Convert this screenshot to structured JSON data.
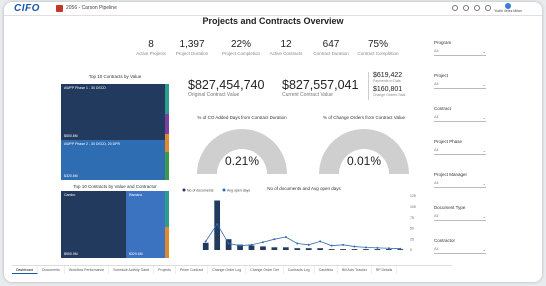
{
  "topbar": {
    "logo": "CIFO",
    "project_name": "2056 - Carson Pipeline",
    "user_name": "Yudhi Velez Milan"
  },
  "page_title": "Projects and Contracts Overview",
  "kpis": [
    {
      "value": "8",
      "label": "Active Projects"
    },
    {
      "value": "1,397",
      "label": "Project Duration"
    },
    {
      "value": "22%",
      "label": "Project Completion"
    },
    {
      "value": "12",
      "label": "Active Contracts"
    },
    {
      "value": "647",
      "label": "Contract Duration"
    },
    {
      "value": "75%",
      "label": "Contract Completion"
    }
  ],
  "money": {
    "original_value": "$827,454,740",
    "original_label": "Original Contract Value",
    "current_value": "$827,557,041",
    "current_label": "Current Contract Value",
    "side1_value": "$619,422",
    "side1_label": "Payments to Date",
    "side2_value": "$160,801",
    "side2_label": "Change Orders Total"
  },
  "treemap1": {
    "title": "Top 10 Contracts by Value",
    "a_label": "AWPP Phase 1 - 30 DSCD",
    "a_value": "$500.8M",
    "b_label": "AWPP Phase 2 - 30 DSCD, 20 DPR",
    "b_value": "$320.6M"
  },
  "treemap2": {
    "title": "Top 10 Contracts by Value and Contractor",
    "a_label": "Cambo",
    "a_value": "$500.9M",
    "b_label": "Ramano",
    "b_value": "$320.6M"
  },
  "gauge1": {
    "title": "% of CO Added Days from Contract Duration",
    "value": "0.21%",
    "fraction": 0.0021
  },
  "gauge2": {
    "title": "% of Change Orders from Contract Value",
    "value": "0.01%",
    "fraction": 0.0001
  },
  "filters": [
    {
      "label": "Program",
      "value": "All"
    },
    {
      "label": "Project",
      "value": "All"
    },
    {
      "label": "Contract",
      "value": "All"
    },
    {
      "label": "Project Phase",
      "value": "All"
    },
    {
      "label": "Project Manager",
      "value": "All"
    },
    {
      "label": "Document Type",
      "value": "All"
    },
    {
      "label": "Contractor",
      "value": "All"
    }
  ],
  "tabs": [
    {
      "label": "Dashboard",
      "active": true
    },
    {
      "label": "Documents",
      "active": false
    },
    {
      "label": "Workflow Performance",
      "active": false
    },
    {
      "label": "Schedule Activity Gantt",
      "active": false
    },
    {
      "label": "Projects",
      "active": false
    },
    {
      "label": "Prime Contract",
      "active": false
    },
    {
      "label": "Change Order Log",
      "active": false
    },
    {
      "label": "Change Order Det",
      "active": false
    },
    {
      "label": "Contracts Log",
      "active": false
    },
    {
      "label": "Cashflow",
      "active": false
    },
    {
      "label": "Bill Actv Tracker",
      "active": false
    },
    {
      "label": "RF Details",
      "active": false
    }
  ],
  "colors": {
    "dark_navy": "#223a5e",
    "blue": "#2f6db3",
    "gauge_grey": "#cfcfcf",
    "accent": "#1a56a8"
  },
  "chart_data": {
    "type": "bar",
    "title": "No of documents and Avg open days",
    "series": [
      {
        "name": "No of documents",
        "type": "bar",
        "values": [
          8,
          55,
          12,
          6,
          5,
          4,
          3,
          3,
          2,
          2,
          2,
          1,
          1,
          1,
          1,
          1,
          1,
          1
        ]
      },
      {
        "name": "Avg open days",
        "type": "line",
        "values": [
          20,
          60,
          15,
          10,
          12,
          18,
          25,
          30,
          15,
          12,
          20,
          10,
          12,
          8,
          6,
          5,
          4,
          3
        ]
      }
    ],
    "ylim_left": [
      0,
      60
    ],
    "ylim_right": [
      0,
      125
    ],
    "yticks_right": [
      "125",
      "100",
      "75",
      "50",
      "25",
      "0"
    ],
    "legend": "top-left"
  }
}
